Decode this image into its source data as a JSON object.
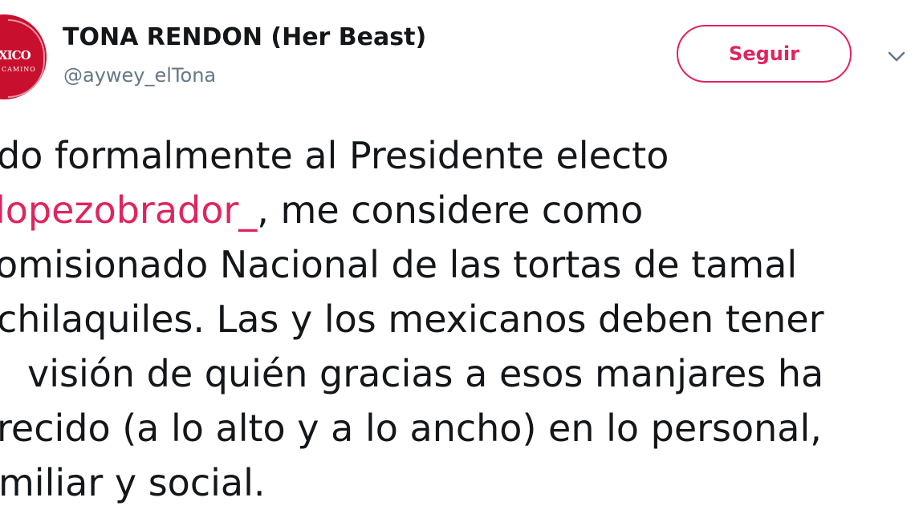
{
  "author": {
    "display_name": "TONA RENDON (Her Beast)",
    "handle": "@aywey_elTona",
    "avatar_text": "XICO",
    "avatar_subtext": "CAMINO"
  },
  "actions": {
    "follow_label": "Seguir",
    "menu_icon": "chevron-down-icon"
  },
  "tweet": {
    "lines": [
      {
        "pre": "do formalmente al Presidente electo",
        "mention": "",
        "post": ""
      },
      {
        "pre": "",
        "mention": "lopezobrador_",
        "post": ", me considere como"
      },
      {
        "pre": "omisionado Nacional de las tortas de tamal",
        "mention": "",
        "post": ""
      },
      {
        "pre": "chilaquiles. Las y los mexicanos deben tener",
        "mention": "",
        "post": ""
      },
      {
        "pre": "visión de quién gracias a esos manjares ha",
        "mention": "",
        "post": ""
      },
      {
        "pre": "recido (a lo alto y a lo ancho) en lo personal,",
        "mention": "",
        "post": ""
      },
      {
        "pre": "miliar y social.",
        "mention": "",
        "post": ""
      }
    ]
  },
  "colors": {
    "accent": "#e0245e",
    "avatar_bg": "#c8102e",
    "handle": "#657786",
    "text": "#14171a"
  }
}
